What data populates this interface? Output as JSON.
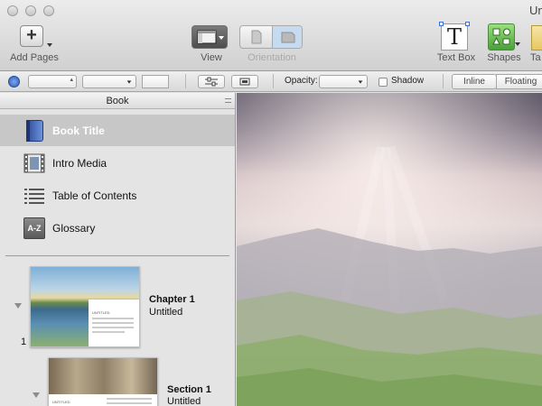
{
  "window": {
    "title": "Un"
  },
  "toolbar": {
    "add_pages_label": "Add Pages",
    "view_label": "View",
    "orientation_label": "Orientation",
    "text_box_label": "Text Box",
    "shapes_label": "Shapes",
    "table_label_partial": "Ta",
    "text_box_glyph": "T",
    "add_glyph": "+"
  },
  "formatbar": {
    "opacity_label": "Opacity:",
    "shadow_label": "Shadow",
    "inline_label": "Inline",
    "floating_label": "Floating"
  },
  "sidebar": {
    "header": "Book",
    "items": [
      {
        "label": "Book Title",
        "icon": "book-icon",
        "selected": true
      },
      {
        "label": "Intro Media",
        "icon": "film-icon",
        "selected": false
      },
      {
        "label": "Table of Contents",
        "icon": "list-icon",
        "selected": false
      },
      {
        "label": "Glossary",
        "icon": "glossary-icon",
        "selected": false,
        "icon_text": "A-Z"
      }
    ],
    "thumbnails": [
      {
        "page_number": "1",
        "title": "Chapter 1",
        "subtitle": "Untitled",
        "thumb_caption": "UNTITLED"
      },
      {
        "page_number": "",
        "title": "Section 1",
        "subtitle": "Untitled",
        "thumb_caption": "UNTITLED"
      }
    ]
  },
  "colors": {
    "selection": "#c7c7c7",
    "accent_blue": "#3a6fd0",
    "shapes_green": "#4aa03a"
  }
}
